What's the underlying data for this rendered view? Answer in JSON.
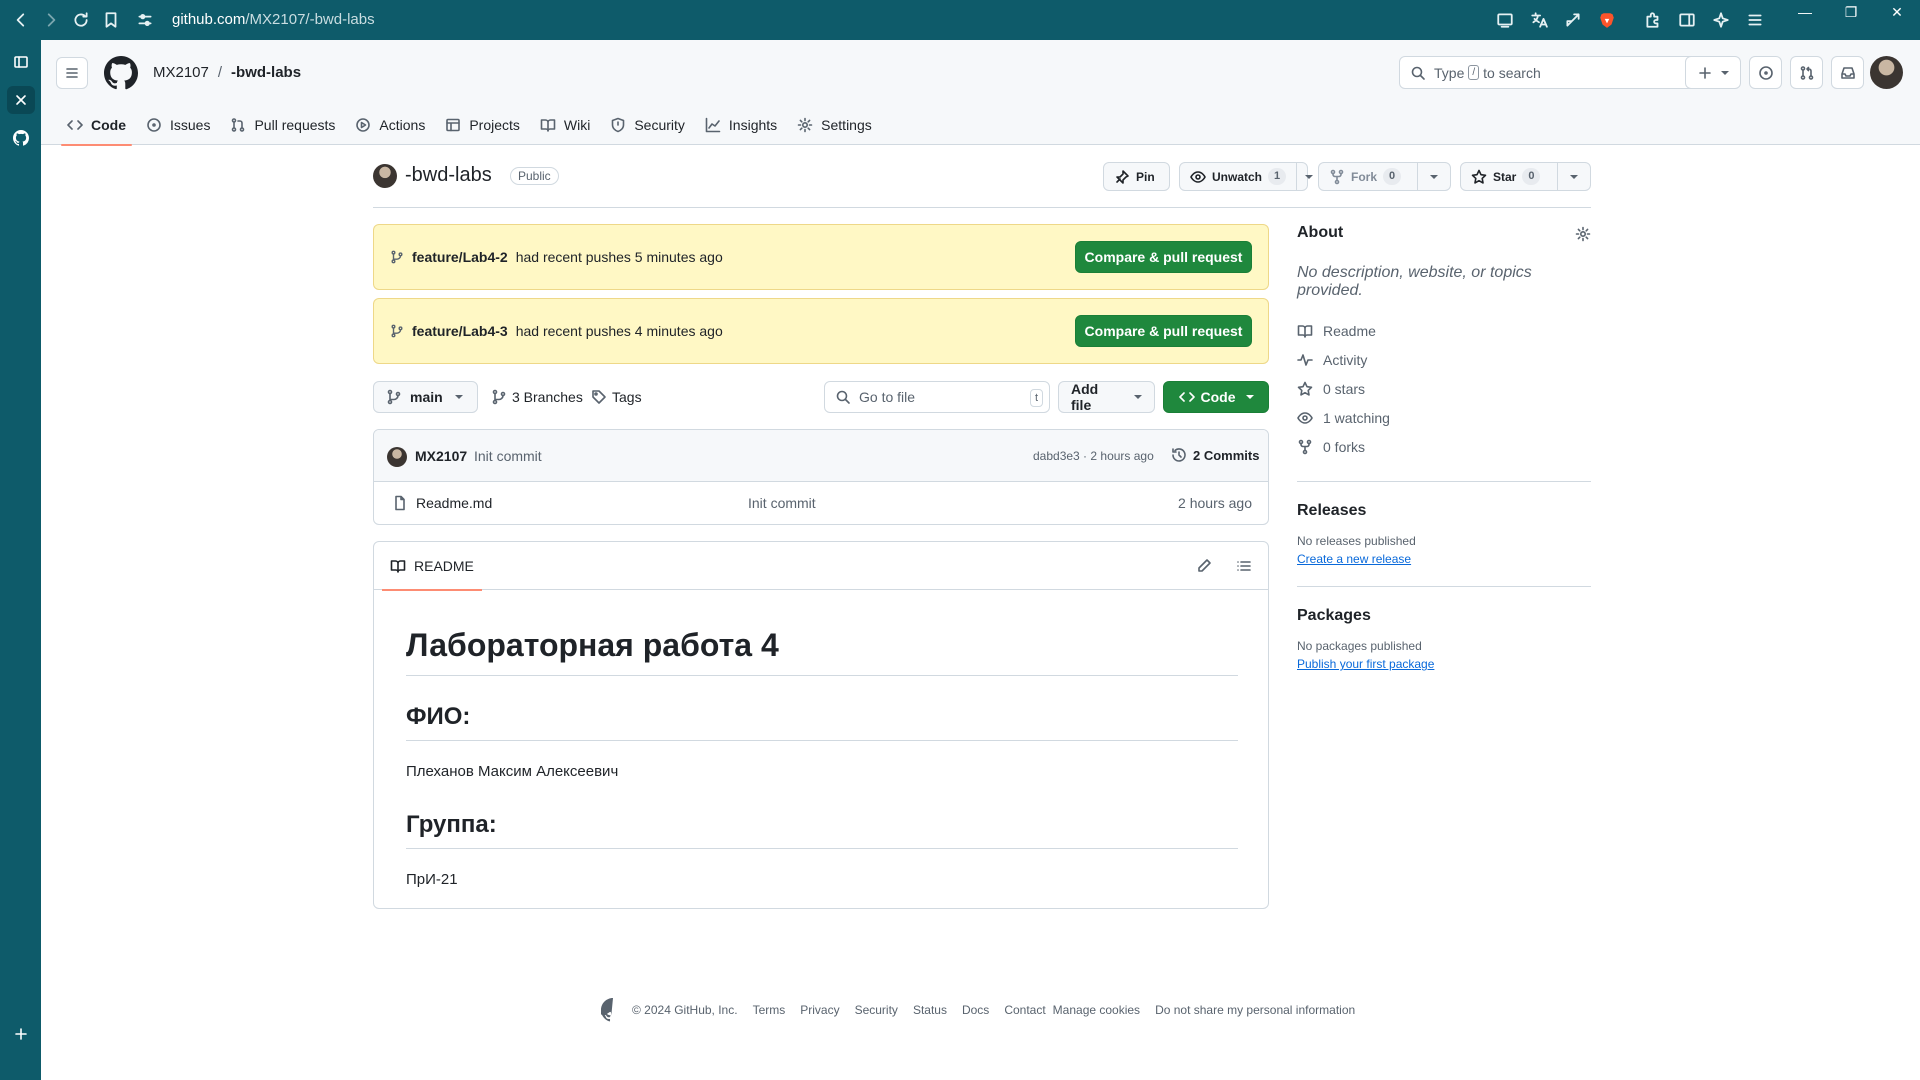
{
  "browser": {
    "url_host": "github.com",
    "url_path": "/MX2107/-bwd-labs"
  },
  "header": {
    "owner": "MX2107",
    "separator": "/",
    "repo": "-bwd-labs",
    "search_prefix": "Type",
    "search_key": "/",
    "search_suffix": "to search"
  },
  "tabs": [
    {
      "label": "Code",
      "icon": "code-icon"
    },
    {
      "label": "Issues",
      "icon": "issue-icon"
    },
    {
      "label": "Pull requests",
      "icon": "pull-request-icon"
    },
    {
      "label": "Actions",
      "icon": "play-icon"
    },
    {
      "label": "Projects",
      "icon": "table-icon"
    },
    {
      "label": "Wiki",
      "icon": "book-icon"
    },
    {
      "label": "Security",
      "icon": "shield-icon"
    },
    {
      "label": "Insights",
      "icon": "graph-icon"
    },
    {
      "label": "Settings",
      "icon": "gear-icon"
    }
  ],
  "repo": {
    "name": "-bwd-labs",
    "visibility": "Public",
    "pin_label": "Pin",
    "unwatch_label": "Unwatch",
    "unwatch_count": "1",
    "fork_label": "Fork",
    "fork_count": "0",
    "star_label": "Star",
    "star_count": "0"
  },
  "banners": [
    {
      "branch": "feature/Lab4-2",
      "text": "had recent pushes 5 minutes ago",
      "button": "Compare & pull request"
    },
    {
      "branch": "feature/Lab4-3",
      "text": "had recent pushes 4 minutes ago",
      "button": "Compare & pull request"
    }
  ],
  "file_nav": {
    "branch": "main",
    "branches": "3 Branches",
    "tags": "Tags",
    "goto_placeholder": "Go to file",
    "goto_key": "t",
    "add_file": "Add file",
    "code": "Code"
  },
  "commit": {
    "author": "MX2107",
    "message": "Init commit",
    "meta": "dabd3e3 · 2 hours ago",
    "commits": "2 Commits"
  },
  "files": [
    {
      "name": "Readme.md",
      "message": "Init commit",
      "age": "2 hours ago"
    }
  ],
  "readme": {
    "tab": "README",
    "h1": "Лабораторная работа 4",
    "h2_1": "ФИО:",
    "p1": "Плеханов Максим Алексеевич",
    "h2_2": "Группа:",
    "p2": "ПрИ-21"
  },
  "about": {
    "title": "About",
    "description": "No description, website, or topics provided.",
    "items": [
      {
        "label": "Readme",
        "icon": "book-icon"
      },
      {
        "label": "Activity",
        "icon": "pulse-icon"
      },
      {
        "label": "0 stars",
        "icon": "star-icon"
      },
      {
        "label": "1 watching",
        "icon": "eye-icon"
      },
      {
        "label": "0 forks",
        "icon": "fork-icon"
      }
    ],
    "releases_title": "Releases",
    "releases_text": "No releases published",
    "releases_link": "Create a new release",
    "packages_title": "Packages",
    "packages_text": "No packages published",
    "packages_link": "Publish your first package"
  },
  "footer": {
    "copyright": "© 2024 GitHub, Inc.",
    "links": [
      "Terms",
      "Privacy",
      "Security",
      "Status",
      "Docs",
      "Contact",
      "Manage cookies",
      "Do not share my personal information"
    ]
  },
  "colors": {
    "browser_bg": "#0e5b6a",
    "accent_green": "#1f883d",
    "tab_underline": "#fd8c73",
    "banner_bg": "#fff8c5",
    "link": "#0969da"
  }
}
